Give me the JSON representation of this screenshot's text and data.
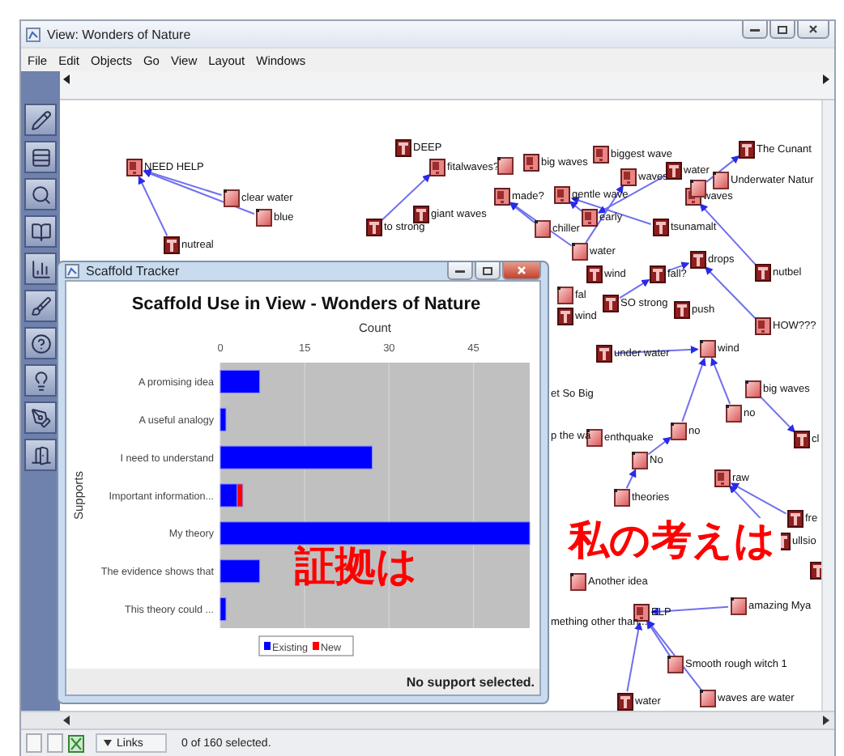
{
  "window": {
    "title": "View: Wonders of Nature"
  },
  "menu": [
    {
      "label": "File"
    },
    {
      "label": "Edit"
    },
    {
      "label": "Objects"
    },
    {
      "label": "Go"
    },
    {
      "label": "View"
    },
    {
      "label": "Layout"
    },
    {
      "label": "Windows"
    }
  ],
  "canvas": {
    "nodes": [
      {
        "label": "NEED HELP",
        "kind": "question"
      },
      {
        "label": "clear water",
        "kind": "plain"
      },
      {
        "label": "blue",
        "kind": "plain"
      },
      {
        "label": "nutreal",
        "kind": "text"
      },
      {
        "label": "DEEP",
        "kind": "text"
      },
      {
        "label": "to strong",
        "kind": "text"
      },
      {
        "label": "giant waves",
        "kind": "text"
      },
      {
        "label": "fitalwaves?",
        "kind": "question"
      },
      {
        "kind": "plain"
      },
      {
        "label": "big waves",
        "kind": "question"
      },
      {
        "label": "biggest wave",
        "kind": "question"
      },
      {
        "label": "waves",
        "kind": "question"
      },
      {
        "label": "water",
        "kind": "text"
      },
      {
        "label": "made?",
        "kind": "question"
      },
      {
        "label": "gentle wave",
        "kind": "question"
      },
      {
        "label": "chiller",
        "kind": "plain"
      },
      {
        "label": "early",
        "kind": "question"
      },
      {
        "label": "water",
        "kind": "plain"
      },
      {
        "label": "waves",
        "kind": "question"
      },
      {
        "label": "tsunamalt",
        "kind": "text"
      },
      {
        "label": "drops",
        "kind": "text"
      },
      {
        "label": "The Cunant",
        "kind": "text"
      },
      {
        "kind": "plain"
      },
      {
        "label": "Underwater Natur",
        "kind": "plain"
      },
      {
        "label": "wind",
        "kind": "text"
      },
      {
        "label": "fall?",
        "kind": "text"
      },
      {
        "label": "fal",
        "kind": "plain"
      },
      {
        "label": "wind",
        "kind": "text"
      },
      {
        "label": "SO strong",
        "kind": "text"
      },
      {
        "label": "push",
        "kind": "text"
      },
      {
        "label": "nutbel",
        "kind": "text"
      },
      {
        "label": "HOW???",
        "kind": "question"
      },
      {
        "label": "under water",
        "kind": "text"
      },
      {
        "label": "wind",
        "kind": "plain"
      },
      {
        "label": "big waves",
        "kind": "plain"
      },
      {
        "label": "no",
        "kind": "plain"
      },
      {
        "label": "no",
        "kind": "plain"
      },
      {
        "label": "No",
        "kind": "plain"
      },
      {
        "label": "enthquake",
        "kind": "plain"
      },
      {
        "label": "cl",
        "kind": "text"
      },
      {
        "label": "raw",
        "kind": "question"
      },
      {
        "label": "theories",
        "kind": "plain"
      },
      {
        "label": "fre",
        "kind": "text"
      },
      {
        "label": "ullsio",
        "kind": "text"
      },
      {
        "kind": "text"
      },
      {
        "label": "Another idea",
        "kind": "plain"
      },
      {
        "label": "ELP",
        "kind": "question"
      },
      {
        "label": "amazing Mya",
        "kind": "plain"
      },
      {
        "label": "Smooth rough witch 1",
        "kind": "plain"
      },
      {
        "label": "water",
        "kind": "text"
      },
      {
        "label": "waves are water",
        "kind": "plain"
      }
    ],
    "fragments": [
      "et So Big",
      "p the wa",
      "mething other than..."
    ]
  },
  "tracker": {
    "title": "Scaffold Tracker",
    "chart_data": {
      "type": "bar",
      "orientation": "horizontal",
      "stacked": true,
      "title": "Scaffold Use in View - Wonders of Nature",
      "xlabel": "Count",
      "ylabel": "Supports",
      "categories": [
        "A promising idea",
        "A useful analogy",
        "I need to understand",
        "Important information...",
        "My theory",
        "The evidence shows that",
        "This theory could ..."
      ],
      "series": [
        {
          "name": "Existing",
          "color": "#0000ff",
          "values": [
            7,
            1,
            27,
            3,
            55,
            7,
            1
          ]
        },
        {
          "name": "New",
          "color": "#ff0000",
          "values": [
            0,
            0,
            0,
            1,
            0,
            0,
            0
          ]
        }
      ],
      "xlim": [
        0,
        55
      ],
      "xticks": [
        0,
        15,
        30,
        45
      ],
      "grid": true,
      "legend": true
    },
    "status": "No support selected."
  },
  "annotations": [
    {
      "text": "証拠は"
    },
    {
      "text": "私の考えは"
    }
  ],
  "status_bar": {
    "links_menu": "Links",
    "selection": "0 of 160 selected."
  }
}
